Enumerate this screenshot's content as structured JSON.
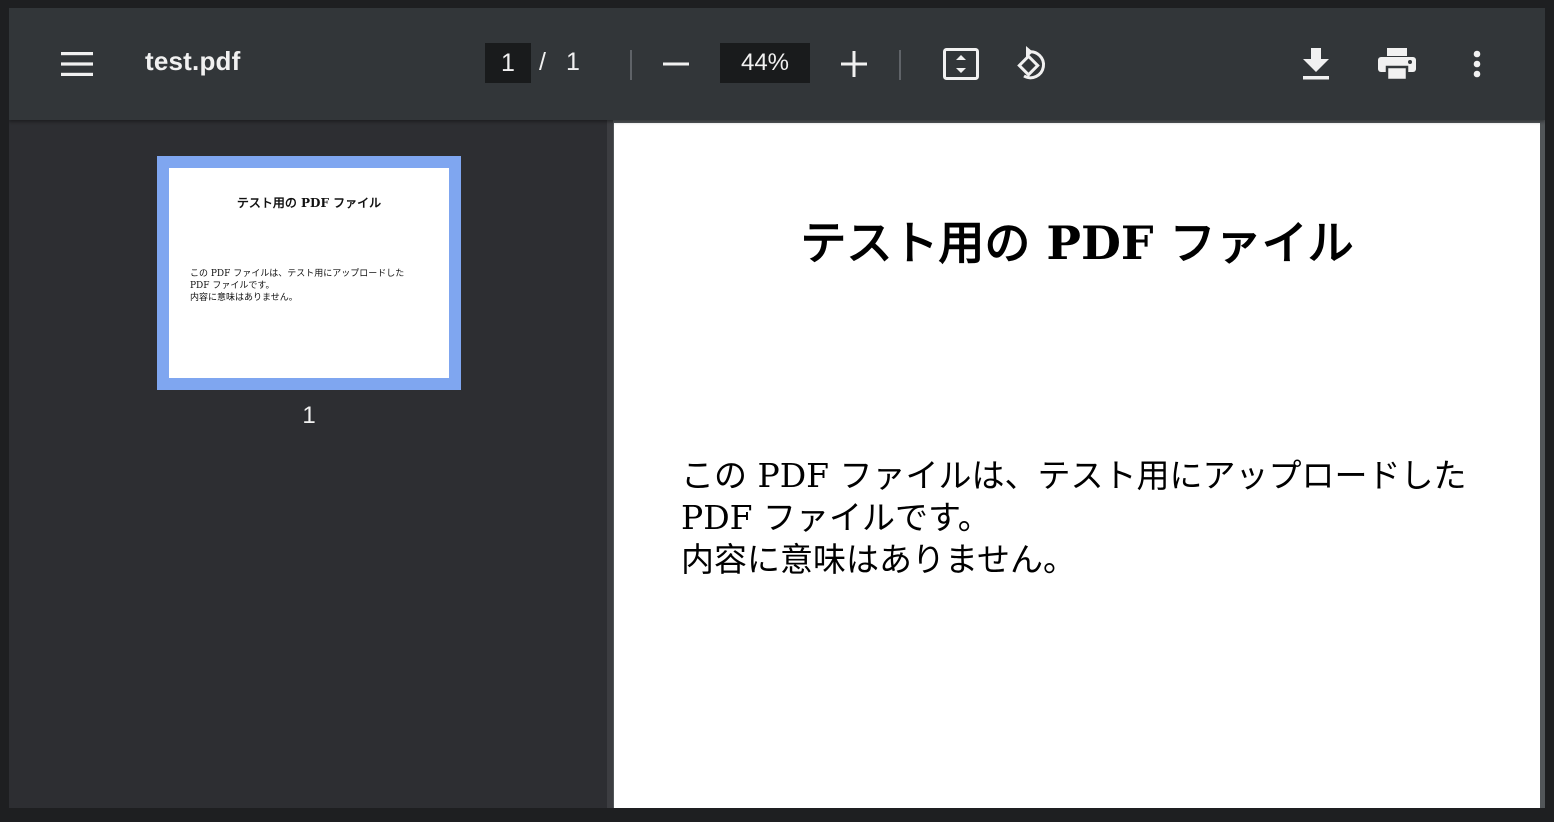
{
  "toolbar": {
    "menu_icon": "hamburger-menu-icon",
    "title": "test.pdf",
    "page_current": "1",
    "page_separator": "/",
    "page_total": "1",
    "zoom_out_icon": "minus-icon",
    "zoom_value": "44%",
    "zoom_in_icon": "plus-icon",
    "fit_icon": "fit-to-page-icon",
    "rotate_icon": "rotate-counterclockwise-icon",
    "download_icon": "download-icon",
    "print_icon": "printer-icon",
    "more_icon": "more-vert-icon"
  },
  "sidebar": {
    "thumbnails": [
      {
        "title": "テスト用の PDF ファイル",
        "lines": [
          "この PDF ファイルは、テスト用にアップロードした",
          "PDF ファイルです。",
          "内容に意味はありません。"
        ],
        "page_number": "1"
      }
    ]
  },
  "document": {
    "title": "テスト用の PDF ファイル",
    "lines": [
      "この PDF ファイルは、テスト用にアップロードした",
      "PDF ファイルです。",
      "内容に意味はありません。"
    ]
  },
  "colors": {
    "toolbar_bg": "#323639",
    "sidebar_bg": "#2d2e32",
    "thumbnail_selected": "#7fa6f0",
    "input_bg": "#191b1c",
    "text": "#f1f1f1"
  }
}
